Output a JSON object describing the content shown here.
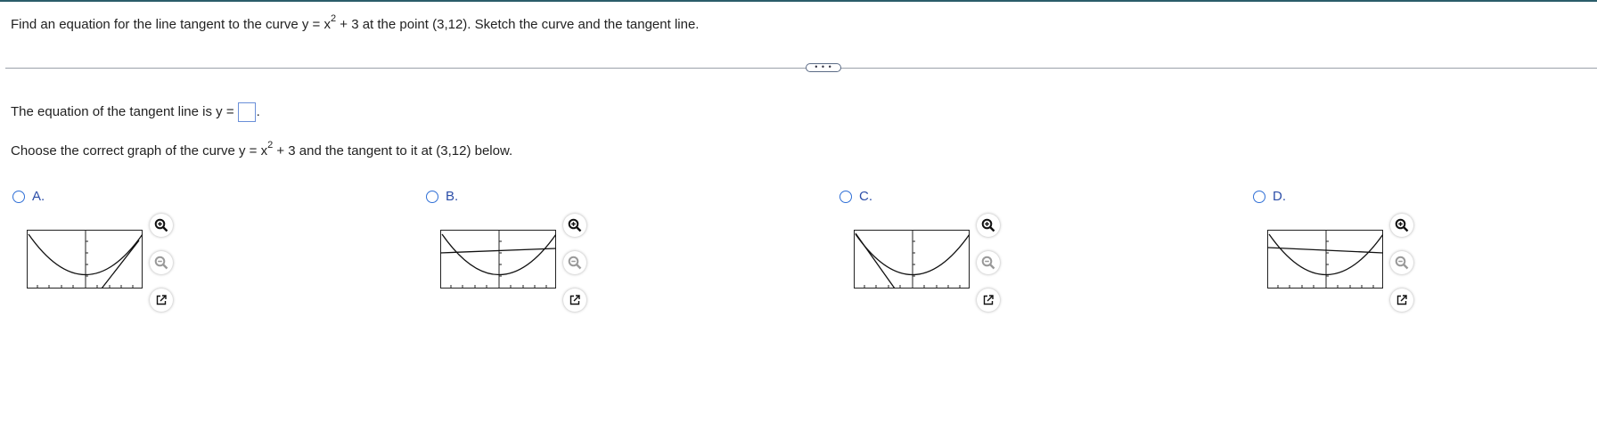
{
  "question": {
    "prefix": "Find an equation for the line tangent to the curve y = x",
    "exponent": "2",
    "suffix": " + 3 at the point (3,12). Sketch the curve and the tangent line."
  },
  "expand_label": "• • •",
  "answer": {
    "prefix": "The equation of the tangent line is y =",
    "value": "",
    "suffix": "."
  },
  "choose": {
    "prefix": "Choose the correct graph of the curve y = x",
    "exponent": "2",
    "suffix": " + 3 and the tangent to it at (3,12) below."
  },
  "choices": [
    {
      "letter": "A."
    },
    {
      "letter": "B."
    },
    {
      "letter": "C."
    },
    {
      "letter": "D."
    }
  ],
  "colors": {
    "accent": "#2f6fd6",
    "choice_letter": "#2c4ea8",
    "answer_box_border": "#6a8fd8",
    "top_rule": "#2a5d6a"
  },
  "icons": [
    "zoom-in-icon",
    "zoom-out-icon",
    "popout-icon"
  ]
}
